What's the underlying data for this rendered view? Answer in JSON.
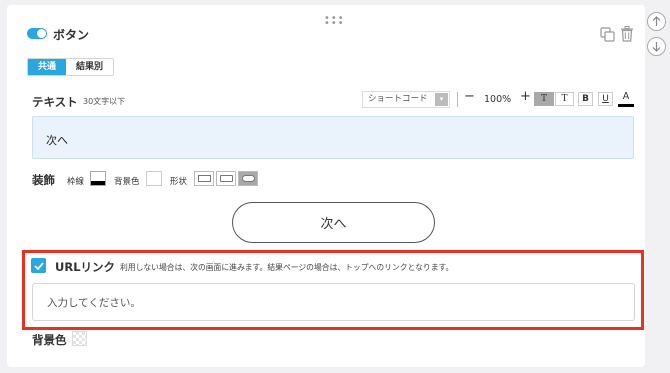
{
  "block": {
    "title": "ボタン",
    "enabled": true
  },
  "tabs": [
    {
      "label": "共通",
      "active": true
    },
    {
      "label": "結果別",
      "active": false
    }
  ],
  "text_section": {
    "label": "テキスト",
    "hint": "30文字以下",
    "value": "次へ"
  },
  "toolbar": {
    "shortcode_label": "ショートコード",
    "minus": "−",
    "zoom": "100%",
    "plus": "+",
    "t_serif_bg": "T",
    "t_serif": "T",
    "bold": "B",
    "underline": "U",
    "font_color": "A"
  },
  "decoration": {
    "label": "装飾",
    "frame_label": "枠線",
    "bg_label": "背景色",
    "shape_label": "形状",
    "frame_color": "#000000",
    "bg_color": "#ffffff",
    "selected_shape": 3
  },
  "preview_button": {
    "label": "次へ"
  },
  "url_link": {
    "checked": true,
    "label": "URLリンク",
    "hint": "利用しない場合は、次の画面に進みます。結果ページの場合は、トップへのリンクとなります。",
    "placeholder": "入力してください。"
  },
  "bottom": {
    "bg_label": "背景色"
  },
  "colors": {
    "accent": "#29a8e0",
    "highlight_border": "#e8321f"
  },
  "icons": [
    "drag-handle-icon",
    "copy-icon",
    "trash-icon",
    "arrow-up-icon",
    "arrow-down-icon",
    "check-icon",
    "dropdown-icon"
  ]
}
